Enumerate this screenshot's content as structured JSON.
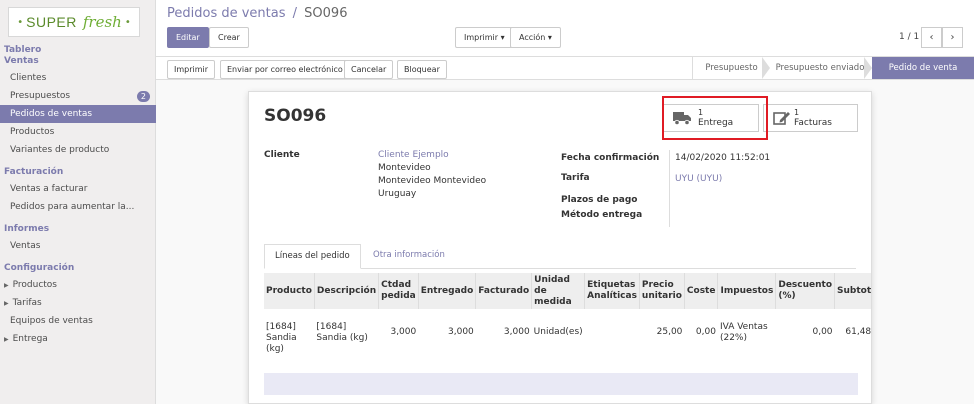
{
  "logo": {
    "left_dot": "•",
    "super": "SUPER",
    "fresh": "fresh",
    "right_dot": "•"
  },
  "sidebar": {
    "sections": [
      {
        "head": "Tablero"
      },
      {
        "head": "Ventas"
      },
      {
        "item": "Clientes"
      },
      {
        "item": "Presupuestos",
        "badge": "2"
      },
      {
        "item": "Pedidos de ventas",
        "active": true
      },
      {
        "item": "Productos"
      },
      {
        "item": "Variantes de producto"
      }
    ],
    "tablero": "Tablero",
    "ventas": "Ventas",
    "clientes": "Clientes",
    "presupuestos": "Presupuestos",
    "presupuestos_badge": "2",
    "pedidos": "Pedidos de ventas",
    "productos": "Productos",
    "variantes": "Variantes de producto",
    "facturacion": "Facturación",
    "ventas_facturar": "Ventas a facturar",
    "pedidos_aumentar": "Pedidos para aumentar la...",
    "informes": "Informes",
    "informes_ventas": "Ventas",
    "configuracion": "Configuración",
    "cfg_productos": "Productos",
    "cfg_tarifas": "Tarifas",
    "cfg_equipos": "Equipos de ventas",
    "cfg_entrega": "Entrega"
  },
  "breadcrumb": {
    "parent": "Pedidos de ventas",
    "separator": "/",
    "current": "SO096"
  },
  "toolbar": {
    "edit": "Editar",
    "create": "Crear",
    "print": "Imprimir ▾",
    "action": "Acción ▾",
    "pager": "1 / 1",
    "prev": "‹",
    "next": "›"
  },
  "statusbar": {
    "buttons": [
      "Imprimir",
      "Enviar por correo electrónico",
      "Cancelar",
      "Bloquear"
    ],
    "stages": [
      "Presupuesto",
      "Presupuesto enviado",
      "Pedido de venta"
    ]
  },
  "sheet": {
    "title": "SO096",
    "smart_buttons": {
      "delivery_count": "1",
      "delivery_label": "Entrega",
      "invoice_count": "1",
      "invoice_label": "Facturas"
    },
    "fields": {
      "client_label": "Cliente",
      "client_name": "Cliente Ejemplo",
      "address_1": "Montevideo",
      "address_2": "Montevideo Montevideo",
      "address_3": "Uruguay",
      "confirm_label": "Fecha confirmación",
      "confirm_value": "14/02/2020 11:52:01",
      "pricelist_label": "Tarifa",
      "pricelist_value": "UYU (UYU)",
      "payment_label": "Plazos de pago",
      "delivery_method_label": "Método entrega"
    },
    "tabs": [
      "Líneas del pedido",
      "Otra información"
    ],
    "table": {
      "headers": [
        "Producto",
        "Descripción",
        "Ctdad pedida",
        "Entregado",
        "Facturado",
        "Unidad de medida",
        "Etiquetas Analíticas",
        "Precio unitario",
        "Coste",
        "Impuestos",
        "Descuento (%)",
        "Subtot"
      ],
      "rows": [
        [
          "[1684] Sandia (kg)",
          "[1684] Sandia (kg)",
          "3,000",
          "3,000",
          "3,000",
          "Unidad(es)",
          "",
          "25,00",
          "0,00",
          "IVA Ventas (22%)",
          "0,00",
          "61,48"
        ]
      ]
    }
  },
  "colors": {
    "brand": "#7c7bad",
    "highlight": "#e01b24",
    "logo_green": "#6fae36"
  }
}
